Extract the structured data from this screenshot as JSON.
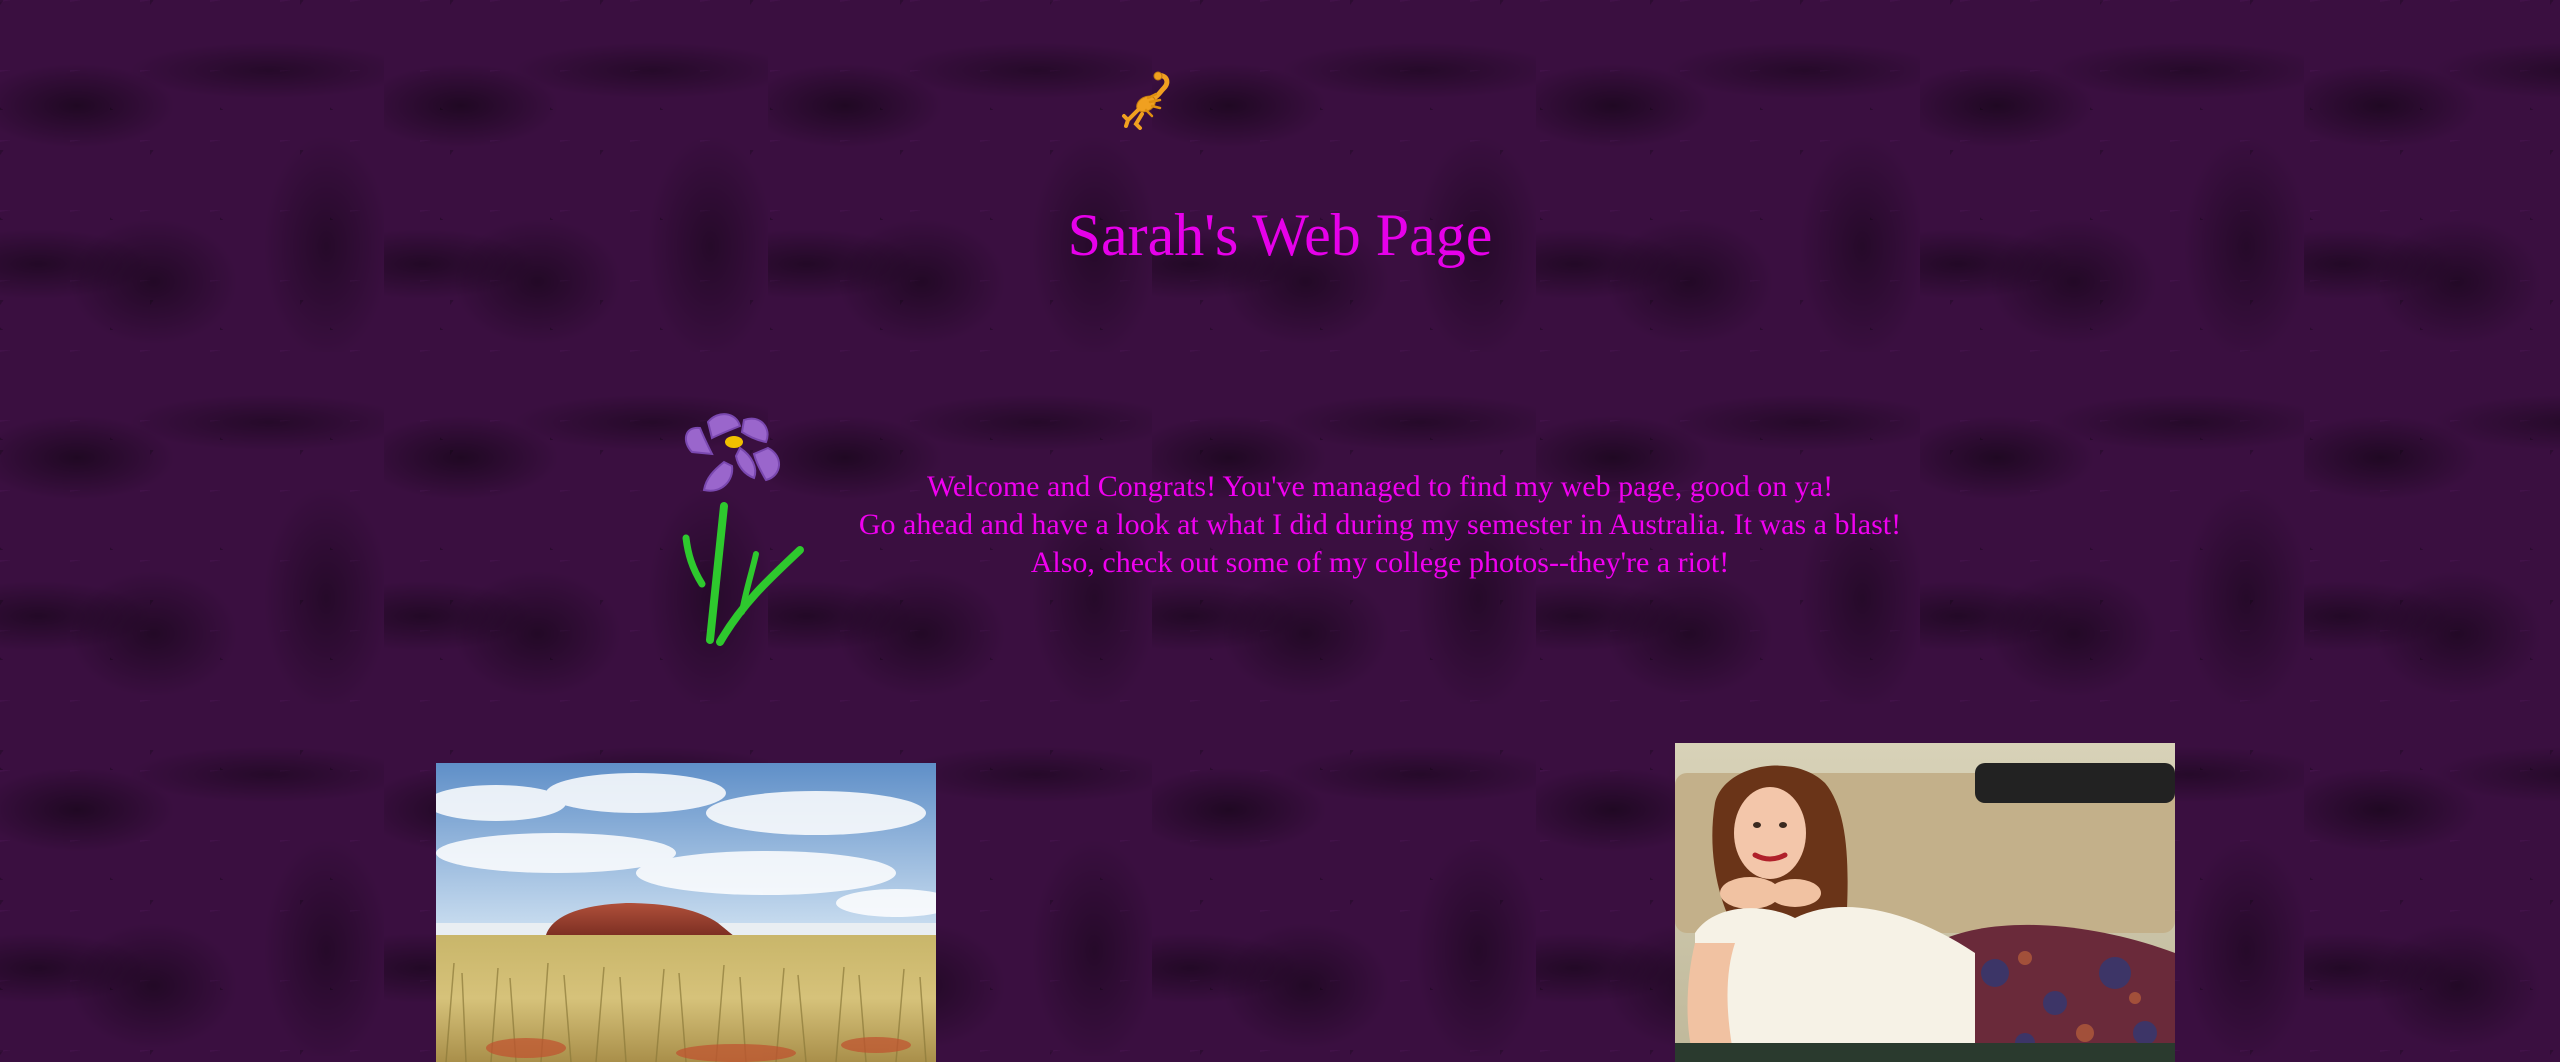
{
  "page": {
    "title": "Sarah's Web Page",
    "welcome_lines": [
      "Welcome and Congrats! You've managed to find my web page, good on ya!",
      "Go ahead and have a look at what I did during my semester in Australia. It was a blast!",
      "Also, check out some of my college photos--they're a riot!"
    ]
  },
  "images": {
    "scorpion": "scorpion-icon",
    "flower": "purple-flower-icon",
    "australia_photo": "uluru-photo",
    "college_photo": "sarah-portrait-photo"
  },
  "colors": {
    "background": "#3a0f40",
    "title": "#e600ea",
    "text": "#f000f0"
  }
}
